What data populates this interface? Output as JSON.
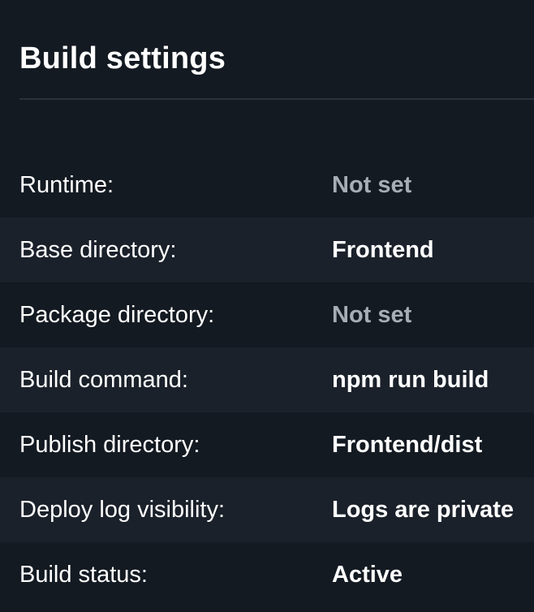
{
  "header": {
    "title": "Build settings"
  },
  "rows": [
    {
      "label": "Runtime:",
      "value": "Not set",
      "muted": true
    },
    {
      "label": "Base directory:",
      "value": "Frontend",
      "muted": false
    },
    {
      "label": "Package directory:",
      "value": "Not set",
      "muted": true
    },
    {
      "label": "Build command:",
      "value": "npm run build",
      "muted": false
    },
    {
      "label": "Publish directory:",
      "value": "Frontend/dist",
      "muted": false
    },
    {
      "label": "Deploy log visibility:",
      "value": "Logs are private",
      "muted": false
    },
    {
      "label": "Build status:",
      "value": "Active",
      "muted": false
    }
  ],
  "colors": {
    "background": "#141a22",
    "row_alt_background": "#1b212a",
    "text_primary": "#ffffff",
    "text_muted": "#a6adb5",
    "divider": "#2b323c"
  }
}
